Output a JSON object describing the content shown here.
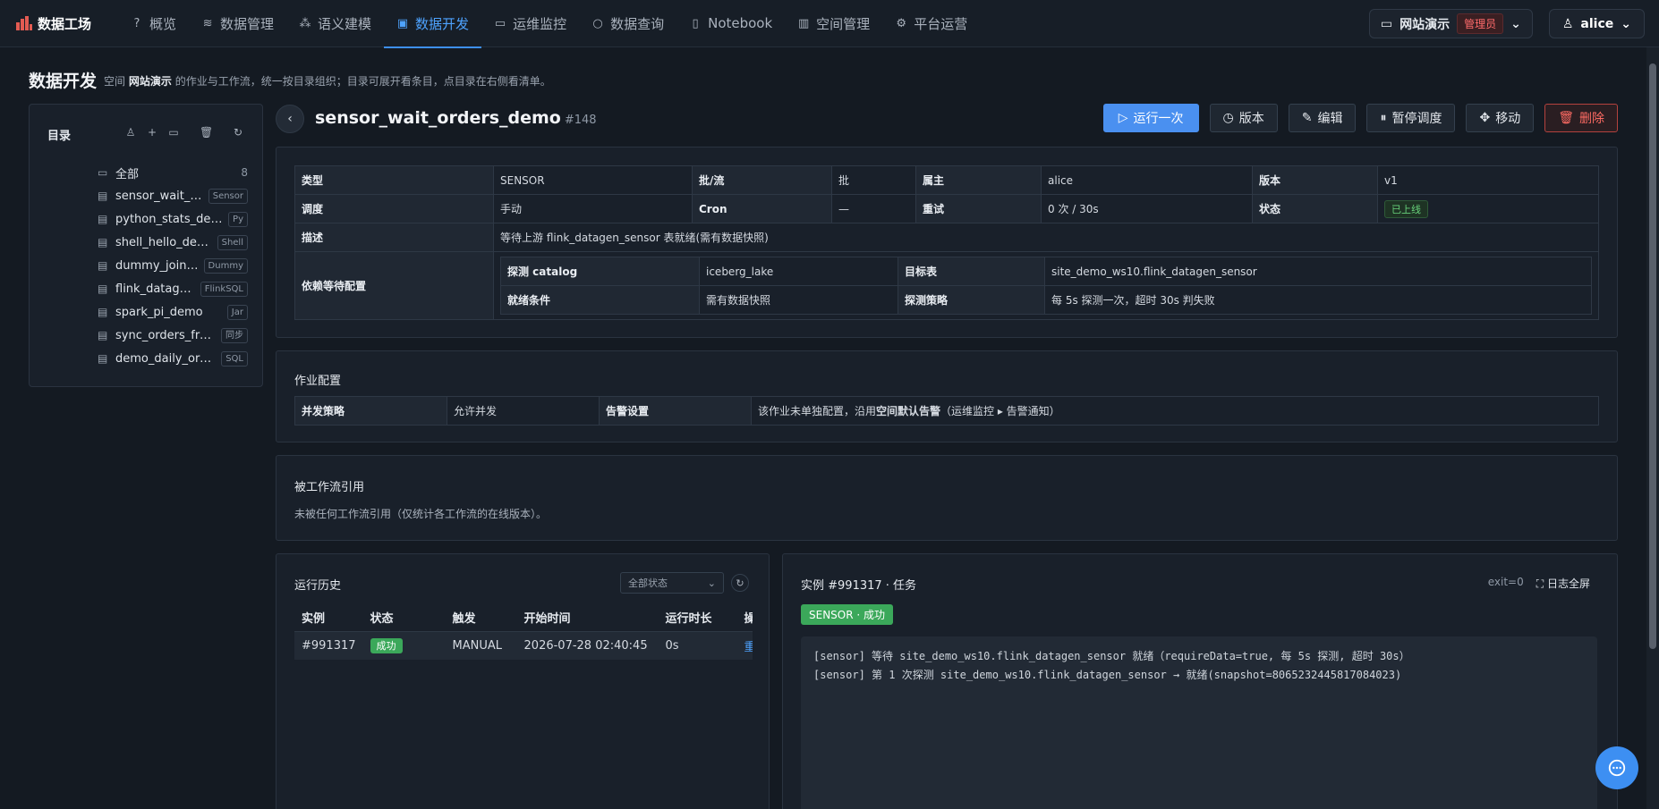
{
  "brand": {
    "name": "数据工场"
  },
  "nav": {
    "tabs": [
      {
        "label": "概览",
        "icon": "?"
      },
      {
        "label": "数据管理",
        "icon": "≋"
      },
      {
        "label": "语义建模",
        "icon": "⁂"
      },
      {
        "label": "数据开发",
        "icon": "▣"
      },
      {
        "label": "运维监控",
        "icon": "▭"
      },
      {
        "label": "数据查询",
        "icon": "○"
      },
      {
        "label": "Notebook",
        "icon": "▯"
      },
      {
        "label": "空间管理",
        "icon": "▥"
      },
      {
        "label": "平台运营",
        "icon": "⚙"
      }
    ],
    "active_index": 3
  },
  "space": {
    "name": "网站演示",
    "role": "管理员"
  },
  "user": {
    "name": "alice"
  },
  "page": {
    "title": "数据开发",
    "desc_prefix": "空间",
    "desc_space": "网站演示",
    "desc_suffix": "的作业与工作流，统一按目录组织；目录可展开看条目，点目录在右侧看清单。"
  },
  "sidebar": {
    "title": "目录",
    "root": {
      "label": "全部",
      "count": "8"
    },
    "items": [
      {
        "label": "sensor_wait_orders_demo",
        "tag": "Sensor"
      },
      {
        "label": "python_stats_demo",
        "tag": "Py"
      },
      {
        "label": "shell_hello_demo",
        "tag": "Shell"
      },
      {
        "label": "dummy_join_demo",
        "tag": "Dummy"
      },
      {
        "label": "flink_datagen_sensor",
        "tag": "FlinkSQL"
      },
      {
        "label": "spark_pi_demo",
        "tag": "Jar"
      },
      {
        "label": "sync_orders_from_mysql",
        "tag": "同步"
      },
      {
        "label": "demo_daily_orders",
        "tag": "SQL"
      }
    ]
  },
  "job": {
    "name": "sensor_wait_orders_demo",
    "id": "#148",
    "actions": {
      "run_once": "运行一次",
      "version": "版本",
      "edit": "编辑",
      "pause": "暂停调度",
      "move": "移动",
      "delete": "删除"
    },
    "info": {
      "type_k": "类型",
      "type_v": "SENSOR",
      "batch_k": "批/流",
      "batch_v": "批",
      "owner_k": "属主",
      "owner_v": "alice",
      "ver_k": "版本",
      "ver_v": "v1",
      "sched_k": "调度",
      "sched_v": "手动",
      "cron_k": "Cron",
      "cron_v": "—",
      "retry_k": "重试",
      "retry_v": "0 次 / 30s",
      "status_k": "状态",
      "status_v": "已上线",
      "desc_k": "描述",
      "desc_v": "等待上游 flink_datagen_sensor 表就绪(需有数据快照)",
      "dep_k": "依赖等待配置",
      "dep": {
        "catalog_k": "探测 catalog",
        "catalog_v": "iceberg_lake",
        "target_k": "目标表",
        "target_v": "site_demo_ws10.flink_datagen_sensor",
        "ready_k": "就绪条件",
        "ready_v": "需有数据快照",
        "policy_k": "探测策略",
        "policy_v": "每 5s 探测一次，超时 30s 判失败"
      }
    },
    "config": {
      "title": "作业配置",
      "concurrency_k": "并发策略",
      "concurrency_v": "允许并发",
      "alert_k": "告警设置",
      "alert_prefix": "该作业未单独配置，沿用",
      "alert_bold": "空间默认告警",
      "alert_suffix": "（运维监控 ▸ 告警通知）"
    },
    "refs": {
      "title": "被工作流引用",
      "text": "未被任何工作流引用（仅统计各工作流的在线版本）。"
    }
  },
  "history": {
    "title": "运行历史",
    "filter": "全部状态",
    "columns": [
      "实例",
      "状态",
      "触发",
      "开始时间",
      "运行时长",
      "操作"
    ],
    "rows": [
      {
        "instance": "#991317",
        "status": "成功",
        "trigger": "MANUAL",
        "start": "2026-07-28 02:40:45",
        "duration": "0s",
        "op": "重跑"
      }
    ]
  },
  "log": {
    "title": "实例 #991317 · 任务",
    "exit": "exit=0",
    "fullscreen": "日志全屏",
    "badge": "SENSOR · 成功",
    "lines": [
      "[sensor] 等待 site_demo_ws10.flink_datagen_sensor 就绪（requireData=true, 每 5s 探测, 超时 30s）",
      "[sensor] 第 1 次探测 site_demo_ws10.flink_datagen_sensor → 就绪(snapshot=8065232445817084023)"
    ]
  }
}
